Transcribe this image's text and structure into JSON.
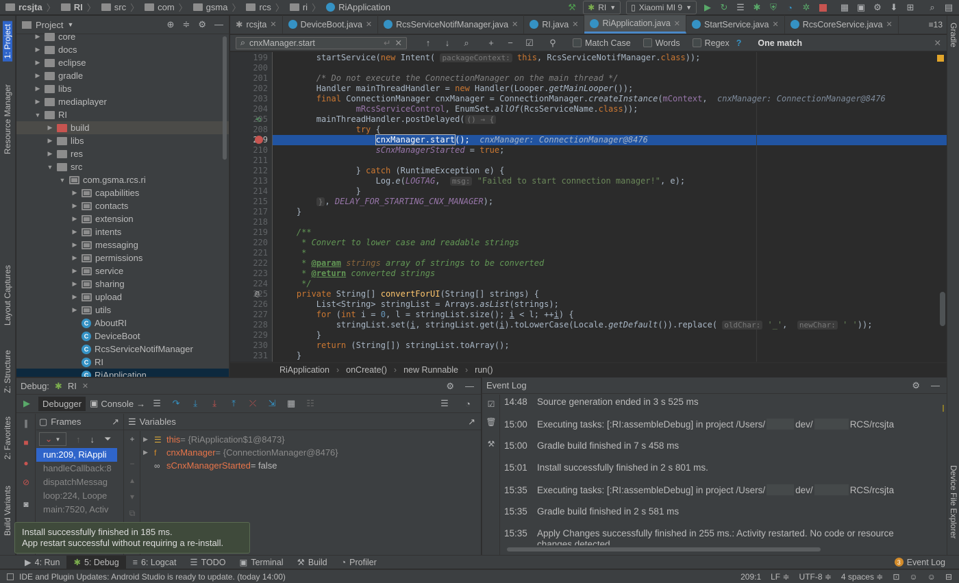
{
  "navbar": {
    "crumbs": [
      "rcsjta",
      "RI",
      "src",
      "com",
      "gsma",
      "rcs",
      "ri",
      "RiApplication"
    ],
    "run_config": "RI",
    "device": "Xiaomi MI 9"
  },
  "left_strip": [
    "1: Project",
    "Resource Manager",
    "Layout Captures",
    "Z: Structure",
    "2: Favorites",
    "Build Variants"
  ],
  "right_strip": [
    "Gradle",
    "Device File Explorer"
  ],
  "project_panel": {
    "title": "Project",
    "tree": [
      {
        "label": "core",
        "type": "folder",
        "depth": 1,
        "arrow": "▶"
      },
      {
        "label": "docs",
        "type": "folder",
        "depth": 1,
        "arrow": "▶"
      },
      {
        "label": "eclipse",
        "type": "folder",
        "depth": 1,
        "arrow": "▶"
      },
      {
        "label": "gradle",
        "type": "folder",
        "depth": 1,
        "arrow": "▶"
      },
      {
        "label": "libs",
        "type": "folder",
        "depth": 1,
        "arrow": "▶"
      },
      {
        "label": "mediaplayer",
        "type": "folder",
        "depth": 1,
        "arrow": "▶"
      },
      {
        "label": "RI",
        "type": "folder",
        "depth": 1,
        "arrow": "▼"
      },
      {
        "label": "build",
        "type": "folder-red",
        "depth": 2,
        "arrow": "▶"
      },
      {
        "label": "libs",
        "type": "folder",
        "depth": 2,
        "arrow": "▶"
      },
      {
        "label": "res",
        "type": "folder",
        "depth": 2,
        "arrow": "▶"
      },
      {
        "label": "src",
        "type": "folder",
        "depth": 2,
        "arrow": "▼"
      },
      {
        "label": "com.gsma.rcs.ri",
        "type": "pkg",
        "depth": 3,
        "arrow": "▼"
      },
      {
        "label": "capabilities",
        "type": "pkg",
        "depth": 4,
        "arrow": "▶"
      },
      {
        "label": "contacts",
        "type": "pkg",
        "depth": 4,
        "arrow": "▶"
      },
      {
        "label": "extension",
        "type": "pkg",
        "depth": 4,
        "arrow": "▶"
      },
      {
        "label": "intents",
        "type": "pkg",
        "depth": 4,
        "arrow": "▶"
      },
      {
        "label": "messaging",
        "type": "pkg",
        "depth": 4,
        "arrow": "▶"
      },
      {
        "label": "permissions",
        "type": "pkg",
        "depth": 4,
        "arrow": "▶"
      },
      {
        "label": "service",
        "type": "pkg",
        "depth": 4,
        "arrow": "▶"
      },
      {
        "label": "sharing",
        "type": "pkg",
        "depth": 4,
        "arrow": "▶"
      },
      {
        "label": "upload",
        "type": "pkg",
        "depth": 4,
        "arrow": "▶"
      },
      {
        "label": "utils",
        "type": "pkg",
        "depth": 4,
        "arrow": "▶"
      },
      {
        "label": "AboutRI",
        "type": "class",
        "depth": 4,
        "arrow": ""
      },
      {
        "label": "DeviceBoot",
        "type": "class",
        "depth": 4,
        "arrow": ""
      },
      {
        "label": "RcsServiceNotifManager",
        "type": "class",
        "depth": 4,
        "arrow": ""
      },
      {
        "label": "RI",
        "type": "class",
        "depth": 4,
        "arrow": ""
      },
      {
        "label": "RiApplication",
        "type": "class",
        "depth": 4,
        "arrow": ""
      }
    ]
  },
  "tabs": [
    {
      "label": "rcsjta",
      "active": false
    },
    {
      "label": "DeviceBoot.java",
      "active": false
    },
    {
      "label": "RcsServiceNotifManager.java",
      "active": false
    },
    {
      "label": "RI.java",
      "active": false
    },
    {
      "label": "RiApplication.java",
      "active": true
    },
    {
      "label": "StartService.java",
      "active": false
    },
    {
      "label": "RcsCoreService.java",
      "active": false
    }
  ],
  "tab_overflow": "≡13",
  "find": {
    "query": "cnxManager.start",
    "match_case": "Match Case",
    "words": "Words",
    "regex": "Regex",
    "help": "?",
    "result": "One match"
  },
  "code_lines": [
    "199",
    "200",
    "201",
    "202",
    "203",
    "204",
    "205",
    "208",
    "209",
    "210",
    "211",
    "212",
    "213",
    "214",
    "215",
    "217",
    "218",
    "219",
    "220",
    "221",
    "222",
    "223",
    "224",
    "225",
    "226",
    "227",
    "228",
    "229",
    "230",
    "231"
  ],
  "editor_breadcrumb": [
    "RiApplication",
    "onCreate()",
    "new Runnable",
    "run()"
  ],
  "debug": {
    "title": "Debug:",
    "config": "RI",
    "tab_debugger": "Debugger",
    "tab_console": "Console",
    "frames_label": "Frames",
    "variables_label": "Variables",
    "frames": [
      "run:209, RiAppli",
      "handleCallback:8",
      "dispatchMessag",
      "loop:224, Loope",
      "main:7520, Activ"
    ],
    "variables": [
      {
        "name": "this",
        "value": " = {RiApplication$1@8473}"
      },
      {
        "name": "cnxManager",
        "value": " = {ConnectionManager@8476}"
      },
      {
        "name": "sCnxManagerStarted",
        "value": " = false"
      }
    ]
  },
  "event_log": {
    "title": "Event Log",
    "entries": [
      {
        "time": "14:48",
        "text": "Source generation ended in 3 s 525 ms"
      },
      {
        "time": "15:00",
        "text": "Executing tasks: [:RI:assembleDebug] in project /Users/",
        "text2": "dev/",
        "text3": "RCS/rcsjta"
      },
      {
        "time": "15:00",
        "text": "Gradle build finished in 7 s 458 ms"
      },
      {
        "time": "15:01",
        "text": "Install successfully finished in 2 s 801 ms."
      },
      {
        "time": "15:35",
        "text": "Executing tasks: [:RI:assembleDebug] in project /Users/",
        "text2": "dev/",
        "text3": "RCS/rcsjta"
      },
      {
        "time": "15:35",
        "text": "Gradle build finished in 2 s 581 ms"
      },
      {
        "time": "15:35",
        "text": "Apply Changes successfully finished in 255 ms.: Activity restarted. No code or resource",
        "text2": "changes detected."
      }
    ]
  },
  "balloon": {
    "line1": "Install successfully finished in 185 ms.",
    "line2": "App restart successful without requiring a re-install."
  },
  "bottom_tabs": [
    {
      "label": "4: Run",
      "icon": "▶"
    },
    {
      "label": "5: Debug",
      "icon": "✱"
    },
    {
      "label": "6: Logcat",
      "icon": "≡"
    },
    {
      "label": "TODO",
      "icon": "☰"
    },
    {
      "label": "Terminal",
      "icon": "▣"
    },
    {
      "label": "Build",
      "icon": "⚒"
    },
    {
      "label": "Profiler",
      "icon": "◔"
    }
  ],
  "event_log_button": {
    "label": "Event Log",
    "count": "3"
  },
  "status": {
    "message": "IDE and Plugin Updates: Android Studio is ready to update. (today 14:00)",
    "position": "209:1",
    "line_sep": "LF ≑",
    "encoding": "UTF-8 ≑",
    "indent": "4 spaces ≑"
  }
}
